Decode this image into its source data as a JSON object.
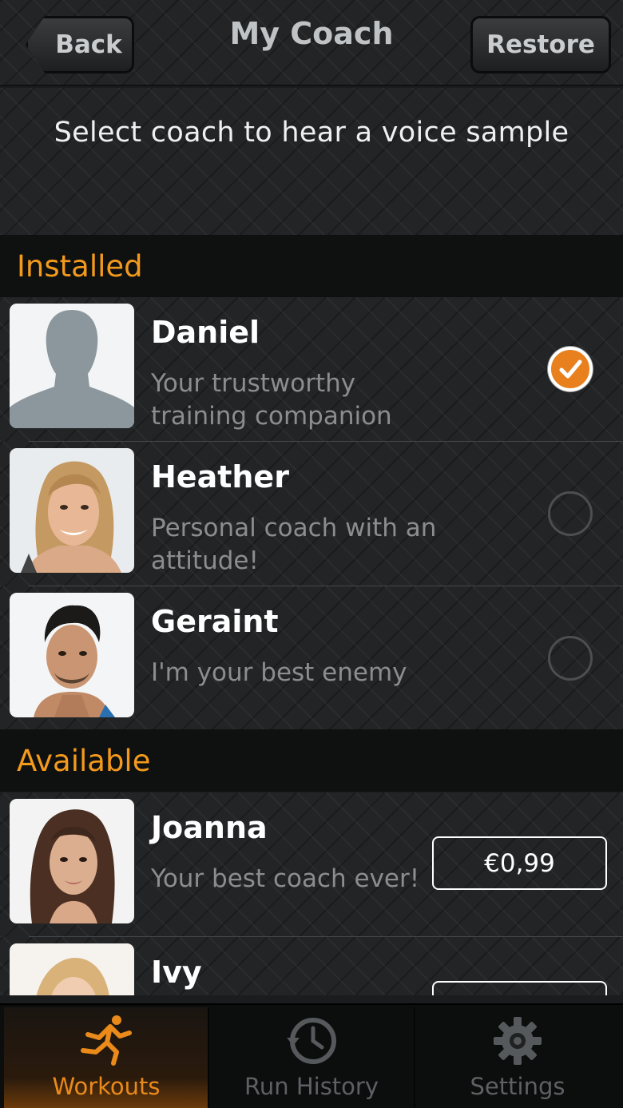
{
  "header": {
    "back_label": "Back",
    "title": "My Coach",
    "restore_label": "Restore"
  },
  "subtitle": "Select coach to hear a voice sample",
  "installed": {
    "header": "Installed",
    "coaches": [
      {
        "name": "Daniel",
        "description": "Your trustworthy training companion",
        "selected": true
      },
      {
        "name": "Heather",
        "description": "Personal coach with an attitude!",
        "selected": false
      },
      {
        "name": "Geraint",
        "description": "I'm your best enemy",
        "selected": false
      }
    ]
  },
  "available": {
    "header": "Available",
    "coaches": [
      {
        "name": "Joanna",
        "description": "Your best coach ever!",
        "price": "€0,99"
      },
      {
        "name": "Ivy",
        "description": "",
        "price": ""
      }
    ]
  },
  "tabs": [
    {
      "label": "Workouts",
      "icon": "runner-icon",
      "active": true
    },
    {
      "label": "Run History",
      "icon": "clock-history-icon",
      "active": false
    },
    {
      "label": "Settings",
      "icon": "gear-icon",
      "active": false
    }
  ],
  "colors": {
    "accent": "#f39a1c",
    "check_fill": "#e8801e",
    "background": "#222425"
  }
}
